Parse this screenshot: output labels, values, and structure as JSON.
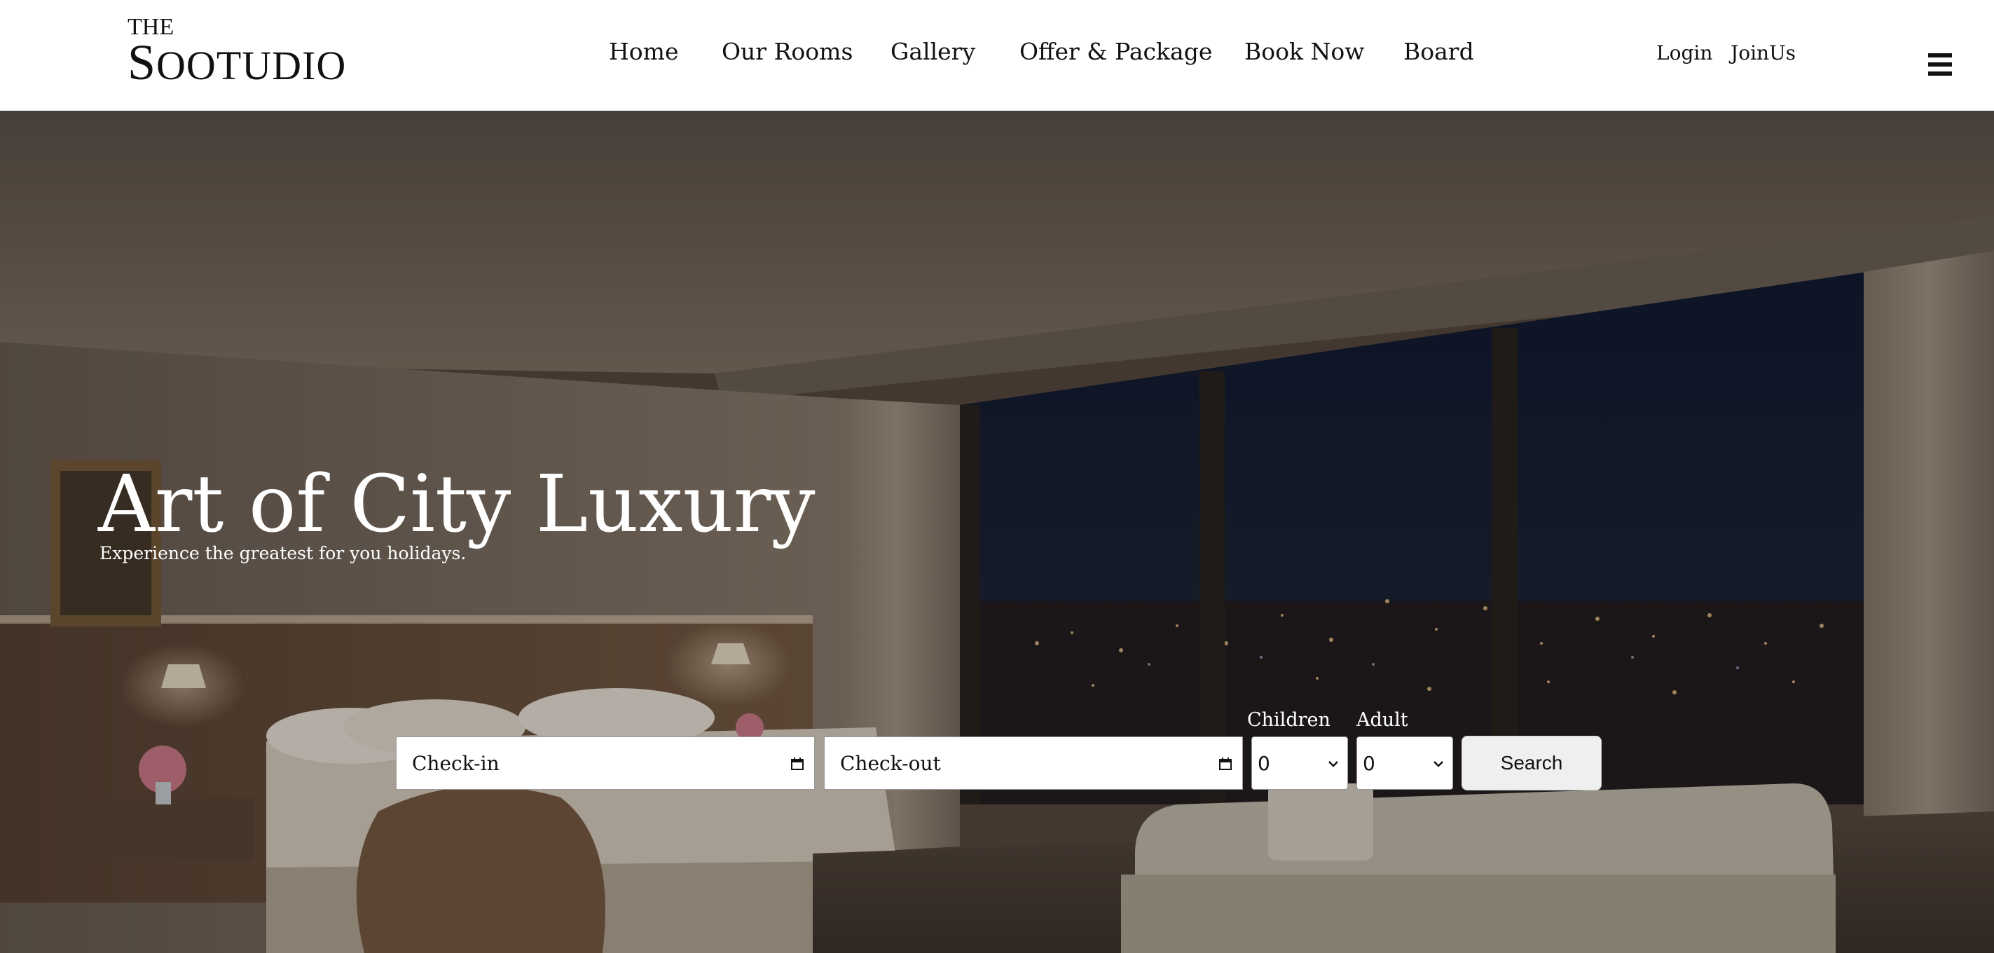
{
  "logo": {
    "top": "THE",
    "main_first": "S",
    "main_rest": "OOTUDIO"
  },
  "nav": {
    "items": [
      "Home",
      "Our Rooms",
      "Gallery",
      "Offer & Package",
      "Book Now",
      "Board"
    ]
  },
  "account": {
    "login": "Login",
    "join": "JoinUs"
  },
  "icons": {
    "menu": "hamburger-menu-icon",
    "calendar": "calendar-icon",
    "dropdown": "chevron-down-icon"
  },
  "hero": {
    "title": "Art of City Luxury",
    "subtitle": "Experience the greatest for you holidays."
  },
  "booking": {
    "checkin_placeholder": "Check-in",
    "checkout_placeholder": "Check-out",
    "children_label": "Children",
    "children_value": "0",
    "adult_label": "Adult",
    "adult_value": "0",
    "search_label": "Search"
  },
  "colors": {
    "header_bg": "#ffffff",
    "text_dark": "#111111",
    "hero_text": "#ffffff",
    "button_bg": "#efefef"
  }
}
